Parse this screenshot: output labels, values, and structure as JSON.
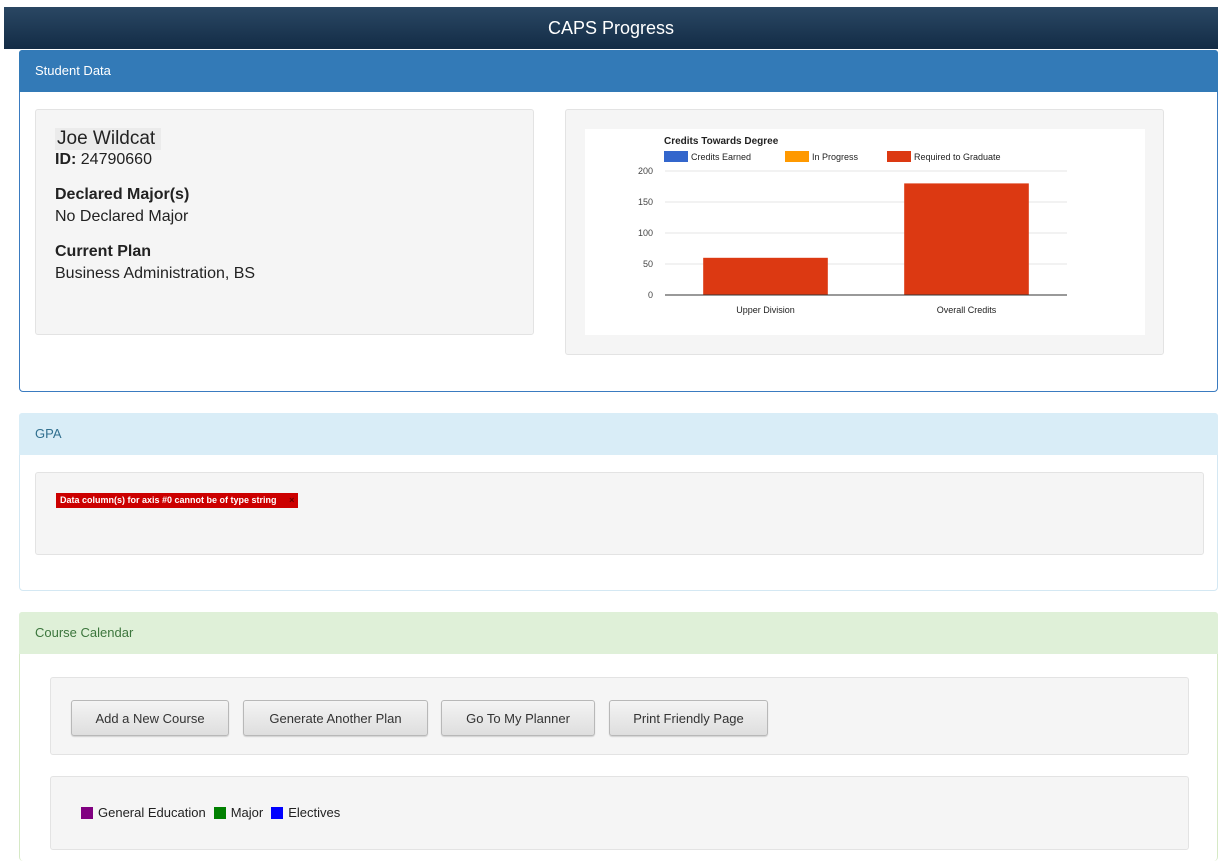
{
  "app": {
    "title": "CAPS Progress"
  },
  "student_panel": {
    "heading": "Student Data",
    "name": "Joe Wildcat",
    "id_label": "ID:",
    "id_value": "24790660",
    "major_label": "Declared Major(s)",
    "major_value": "No Declared Major",
    "plan_label": "Current Plan",
    "plan_value": "Business Administration, BS"
  },
  "gpa_panel": {
    "heading": "GPA",
    "error": "Data column(s) for axis #0 cannot be of type string",
    "error_close": "×"
  },
  "calendar_panel": {
    "heading": "Course Calendar",
    "buttons": [
      "Add a New Course",
      "Generate Another Plan",
      "Go To My Planner",
      "Print Friendly Page"
    ],
    "legend": [
      {
        "label": "General Education",
        "color": "#800080"
      },
      {
        "label": "Major",
        "color": "#008000"
      },
      {
        "label": "Electives",
        "color": "#0000ff"
      }
    ]
  },
  "chart_data": {
    "type": "bar",
    "title": "Credits Towards Degree",
    "categories": [
      "Upper Division",
      "Overall Credits"
    ],
    "series": [
      {
        "name": "Credits Earned",
        "color": "#3366cc",
        "values": [
          0,
          0
        ]
      },
      {
        "name": "In Progress",
        "color": "#ff9900",
        "values": [
          0,
          0
        ]
      },
      {
        "name": "Required to Graduate",
        "color": "#dc3912",
        "values": [
          60,
          180
        ]
      }
    ],
    "ylim": [
      0,
      200
    ],
    "yticks": [
      0,
      50,
      100,
      150,
      200
    ],
    "grid": true,
    "legend_position": "top"
  }
}
